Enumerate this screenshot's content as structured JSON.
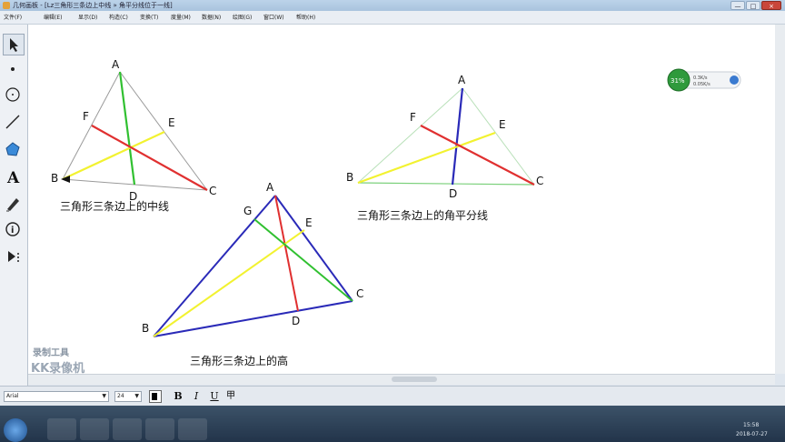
{
  "window": {
    "title": "几何画板 - [Lz三角形三条边上中线 » 角平分线位于一线]",
    "buttons": {
      "minimize": "—",
      "maximize": "□",
      "close": "×"
    }
  },
  "menu": [
    "文件(F)",
    "编辑(E)",
    "显示(D)",
    "构造(C)",
    "变换(T)",
    "度量(M)",
    "数据(N)",
    "绘图(G)",
    "窗口(W)",
    "帮助(H)"
  ],
  "toolbar": {
    "tools": [
      "arrow-tool",
      "point-tool",
      "compass-tool",
      "straightedge-tool",
      "polygon-tool",
      "text-tool",
      "marker-tool",
      "information-tool",
      "custom-tool"
    ],
    "text_tool_glyph": "A"
  },
  "figures": {
    "median": {
      "caption": "三角形三条边上的中线",
      "vertices": {
        "A": "A",
        "B": "B",
        "C": "C",
        "D": "D",
        "E": "E",
        "F": "F"
      }
    },
    "bisector": {
      "caption": "三角形三条边上的角平分线",
      "vertices": {
        "A": "A",
        "B": "B",
        "C": "C",
        "D": "D",
        "E": "E",
        "F": "F"
      }
    },
    "altitude": {
      "caption": "三角形三条边上的高",
      "vertices": {
        "A": "A",
        "B": "B",
        "C": "C",
        "D": "D",
        "E": "E",
        "G": "G"
      }
    }
  },
  "widget": {
    "percent": "31%",
    "line1": "0.3K/s",
    "line2": "0.05K/s"
  },
  "watermark": {
    "top": "录制工具",
    "bottom": "KK录像机"
  },
  "format_bar": {
    "font": "Arial",
    "size": "24",
    "bold": "B",
    "italic": "I",
    "underline": "U",
    "extra": "甲"
  },
  "taskbar": {
    "time": "15:58",
    "date": "2018-07-27"
  },
  "colors": {
    "yellow": "#f2f230",
    "green": "#30c030",
    "red": "#e03030",
    "blue": "#2a2ab8",
    "gray": "#999999",
    "light_green": "#b8e0b8"
  }
}
